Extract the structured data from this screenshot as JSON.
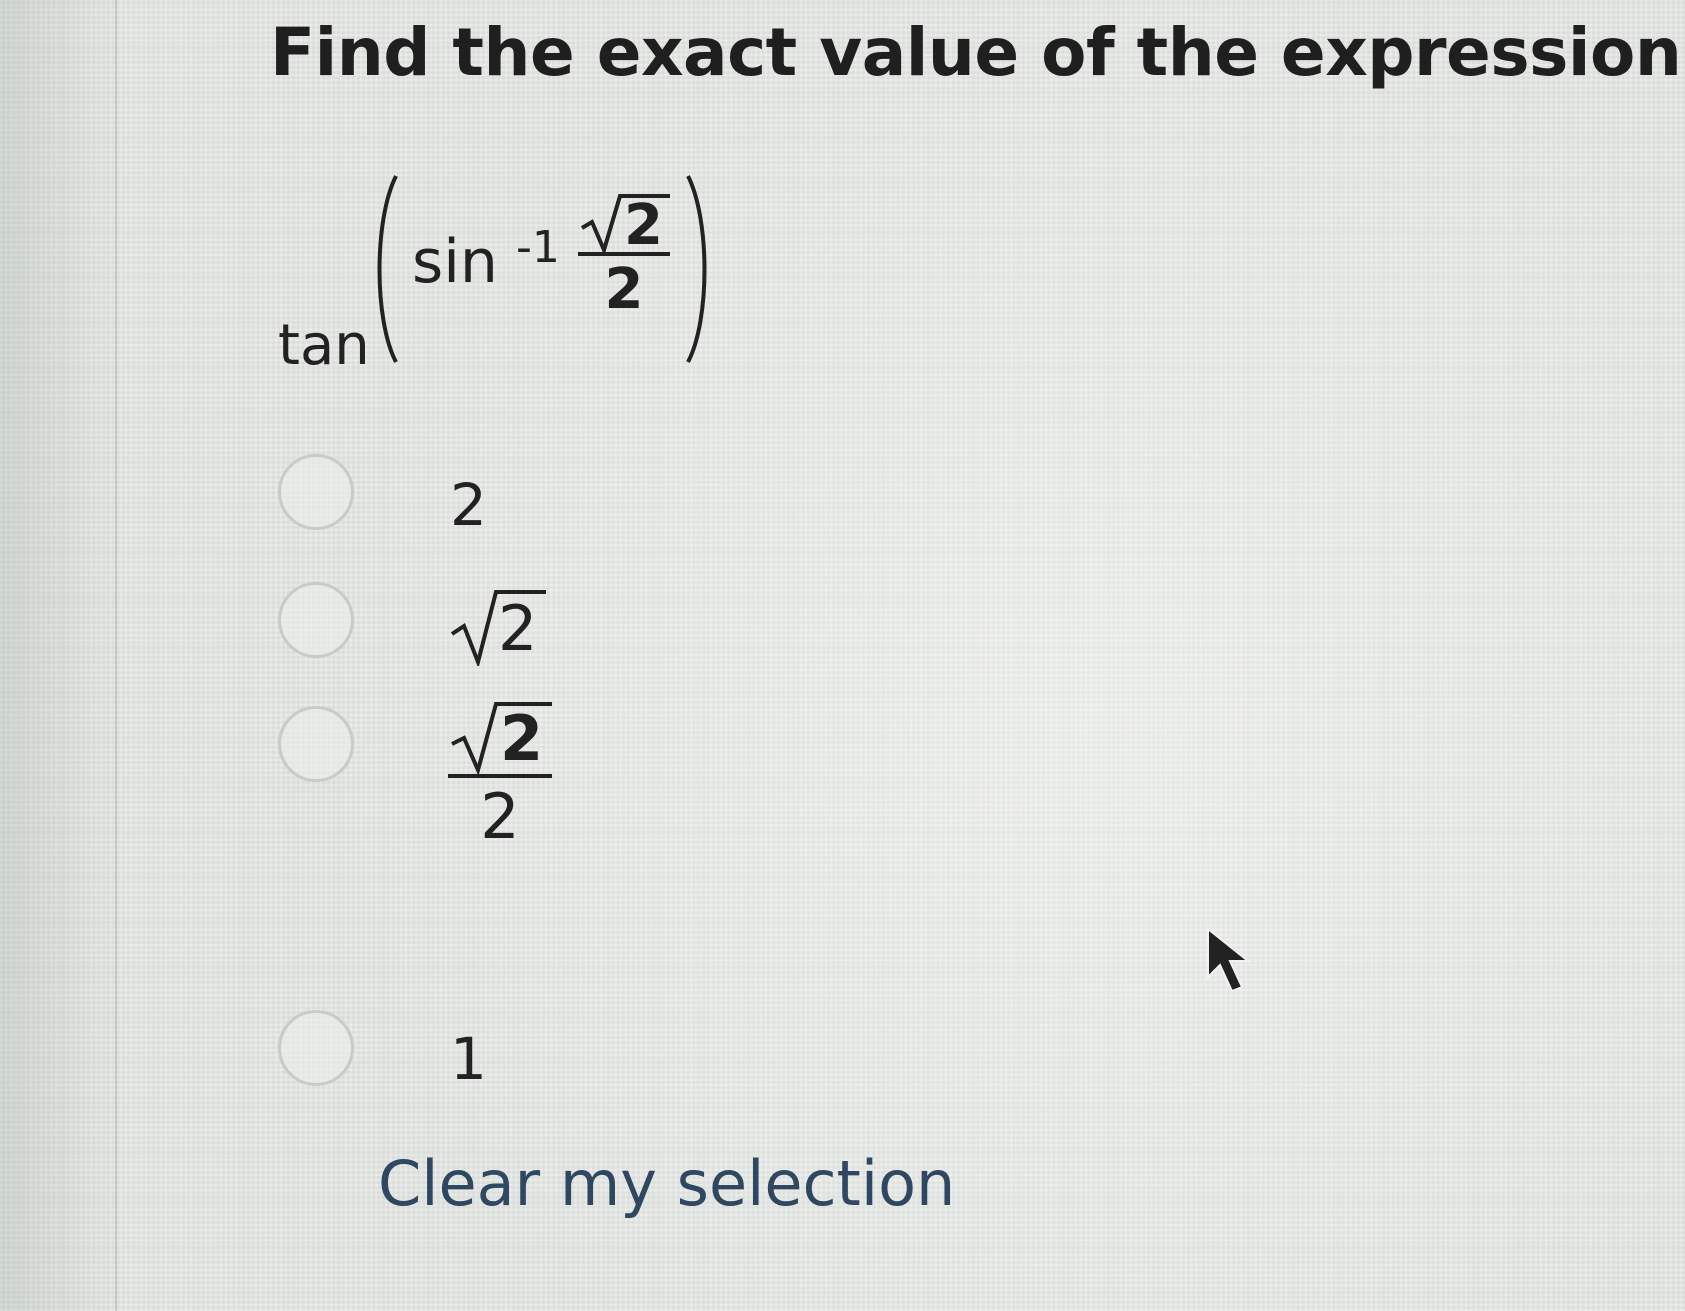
{
  "question": {
    "title": "Find the exact value of the expression.",
    "expression": {
      "outer_fn": "tan",
      "inner_fn": "sin",
      "inner_power": "-1",
      "fraction": {
        "numerator_radicand": "2",
        "denominator": "2"
      }
    }
  },
  "options": [
    {
      "label": "2",
      "kind": "text",
      "selected": false
    },
    {
      "label": "2",
      "kind": "sqrt",
      "radicand": "2",
      "selected": false
    },
    {
      "label": "2",
      "kind": "sqrt-fraction",
      "radicand": "2",
      "denominator": "2",
      "selected": false
    },
    {
      "label": "1",
      "kind": "text",
      "selected": false
    }
  ],
  "actions": {
    "clear_label": "Clear my selection"
  },
  "colors": {
    "background": "#e2e5e1",
    "text": "#222222",
    "link": "#2f4760",
    "radio_border": "#c7ccc7"
  },
  "icons": {
    "cursor": "mouse-pointer-arrow-icon"
  }
}
